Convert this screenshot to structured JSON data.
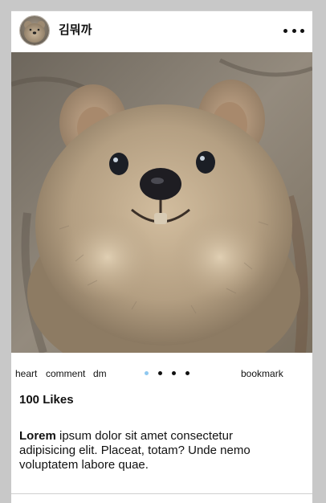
{
  "post": {
    "username": "김뭐까",
    "actions": {
      "heart": "heart",
      "comment": "comment",
      "dm": "dm",
      "bookmark": "bookmark"
    },
    "carousel": {
      "total": 4,
      "active_index": 0,
      "active_color": "#8ec8f0",
      "inactive_color": "#111111"
    },
    "likes": "100 Likes",
    "caption": {
      "bold": "Lorem",
      "text": " ipsum dolor sit amet consectetur adipisicing elit. Placeat, totam? Unde nemo voluptatem labore quae."
    }
  },
  "icons": {
    "more": "more-dots-icon"
  }
}
